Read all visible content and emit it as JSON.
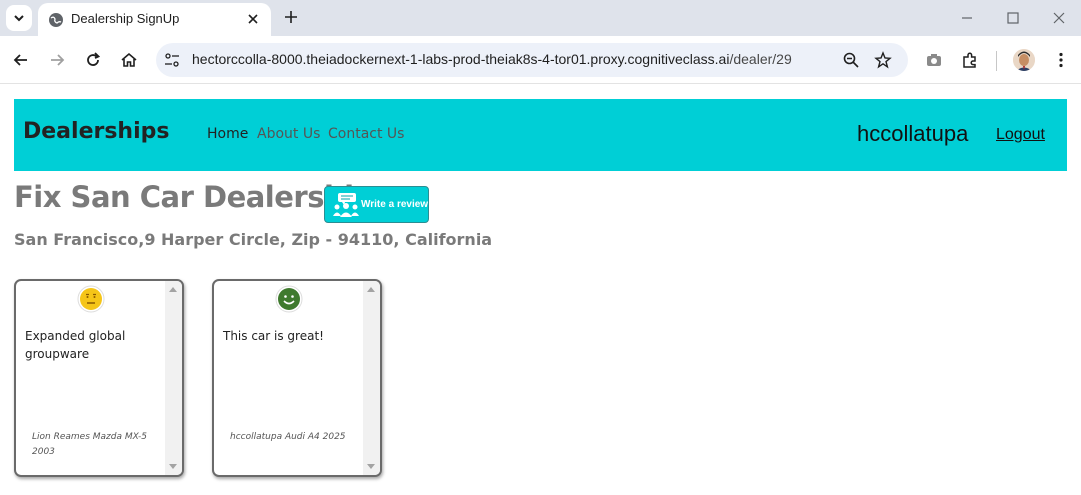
{
  "browser": {
    "tab_title": "Dealership SignUp",
    "url_host": "hectorccolla-8000.theiadockernext-1-labs-prod-theiak8s-4-tor01.proxy.cognitiveclass.ai",
    "url_path": "/dealer/29",
    "icons": [
      "tab-search-icon",
      "globe-icon",
      "close-icon",
      "plus-icon",
      "minimize-icon",
      "maximize-icon",
      "window-close-icon",
      "back-icon",
      "forward-icon",
      "reload-icon",
      "home-icon",
      "site-info-icon",
      "zoom-icon",
      "star-icon",
      "camera-icon",
      "extensions-icon",
      "profile-avatar",
      "kebab-menu-icon"
    ]
  },
  "navbar": {
    "brand": "Dealerships",
    "links": [
      "Home",
      "About Us",
      "Contact Us"
    ],
    "username": "hccollatupa",
    "logout": "Logout",
    "background": "#00cfd6"
  },
  "dealer": {
    "title": "Fix San Car Dealership",
    "review_button": "Write a review",
    "address": "San Francisco,9 Harper Circle, Zip - 94110, California"
  },
  "reviews": [
    {
      "sentiment": "neutral",
      "sentiment_color": "#f5c518",
      "text": "Expanded global groupware",
      "meta": "Lion Reames Mazda MX-5 2003"
    },
    {
      "sentiment": "positive",
      "sentiment_color": "#3f7a2e",
      "text": "This car is great!",
      "meta": "hccollatupa Audi A4 2025"
    }
  ]
}
